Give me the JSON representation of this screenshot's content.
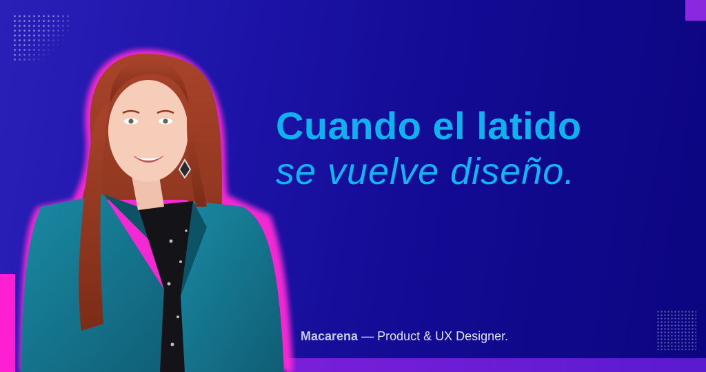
{
  "headline": {
    "line1": "Cuando el latido",
    "line2": "se vuelve diseño."
  },
  "caption": {
    "name": "Macarena",
    "separator": " — ",
    "role": "Product & UX Designer."
  },
  "colors": {
    "background": "#1c13a6",
    "headline": "#0fb2ef",
    "accent_pink": "#ff1fd3",
    "accent_purple": "#7a1fd8",
    "jacket": "#136e86",
    "hair": "#9a3a22"
  }
}
